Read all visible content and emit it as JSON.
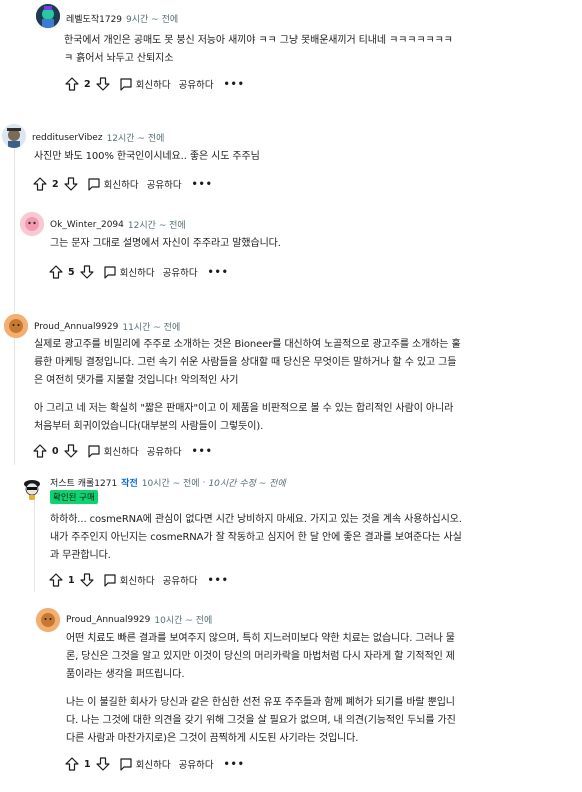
{
  "comments": [
    {
      "user": "레벨도작1729",
      "age": "9시간 ~ 전에",
      "lines": [
        "한국에서 개인은 공매도 못 붕신 저능아 새끼야 ㅋㅋ 그냥 못배운새끼거 티내네 ㅋㅋㅋㅋㅋㅋㅋ",
        "ㅋ 흙어서 놔두고 산퇴지소"
      ],
      "votes": "2"
    },
    {
      "user": "reddituserVibez",
      "age": "12시간 ~ 전에",
      "lines": [
        "사진만 봐도 100% 한국인이시네요.. 좋은 시도 주주님"
      ],
      "votes": "2"
    },
    {
      "user": "Ok_Winter_2094",
      "age": "12시간 ~ 전에",
      "lines": [
        "그는 문자 그대로 설명에서 자신이 주주라고 말했습니다."
      ],
      "votes": "5"
    },
    {
      "user": "Proud_Annual9929",
      "age": "11시간 ~ 전에",
      "para1": [
        "실제로 광고주를 비밀리에 주주로 소개하는 것은 Bioneer를 대신하여 노골적으로 광고주를 소개하는 훌",
        "륭한 마케팅 결정입니다. 그런 속기 쉬운 사람들을 상대할 때 당신은 무엇이든 말하거나 할 수 있고 그들",
        "은 여전히 댓가를 지불할 것입니다! 악의적인 사기"
      ],
      "para2": [
        "아 그리고 네 저는 확실히 \"짧은 판매자\"이고 이 제품을 비판적으로 볼 수 있는 합리적인 사람이 아니라",
        "처음부터 회귀이었습니다(대부분의 사람들이 그렇듯이)."
      ],
      "votes": "0"
    },
    {
      "user": "저스트 캐롤1271",
      "op_label": "작전",
      "age": "10시간 ~ 전에",
      "edited": "10시간 수정 ~ 전에",
      "flair": "확인된 구매",
      "lines": [
        "하하하... cosmeRNA에 관심이 없다면 시간 낭비하지 마세요. 가지고 있는 것을 계속 사용하십시오.",
        "내가 주주인지 아닌지는 cosmeRNA가 잘 작동하고 심지어 한 달 안에 좋은 결과를 보여준다는 사실",
        "과 무관합니다."
      ],
      "votes": "1"
    },
    {
      "user": "Proud_Annual9929",
      "age": "10시간 ~ 전에",
      "para1": [
        "어떤 치료도 빠른 결과를 보여주지 않으며, 특히 지느러미보다 약한 치료는 없습니다. 그러나 물",
        "론, 당신은 그것을 알고 있지만 이것이 당신의 머리카락을 마법처럼 다시 자라게 할 기적적인 제",
        "품이라는 생각을 퍼뜨립니다."
      ],
      "para2": [
        "나는 이 불길한 회사가 당신과 같은 한심한 선전 유포 주주들과 함께 폐허가 되기를 바랄 뿐입니",
        "다. 나는 그것에 대한 의견을 갖기 위해 그것을 살 필요가 없으며, 내 의견(기능적인 두뇌를 가진",
        "다른 사람과 마찬가지로)은 그것이 끔찍하게 시도된 사기라는 것입니다."
      ],
      "votes": "1"
    }
  ],
  "actions": {
    "reply": "회신하다",
    "share": "공유하다",
    "more": "•••"
  },
  "colors": {
    "meta": "#576f76",
    "flair": "#0dd46e",
    "op": "#0a66d8"
  }
}
